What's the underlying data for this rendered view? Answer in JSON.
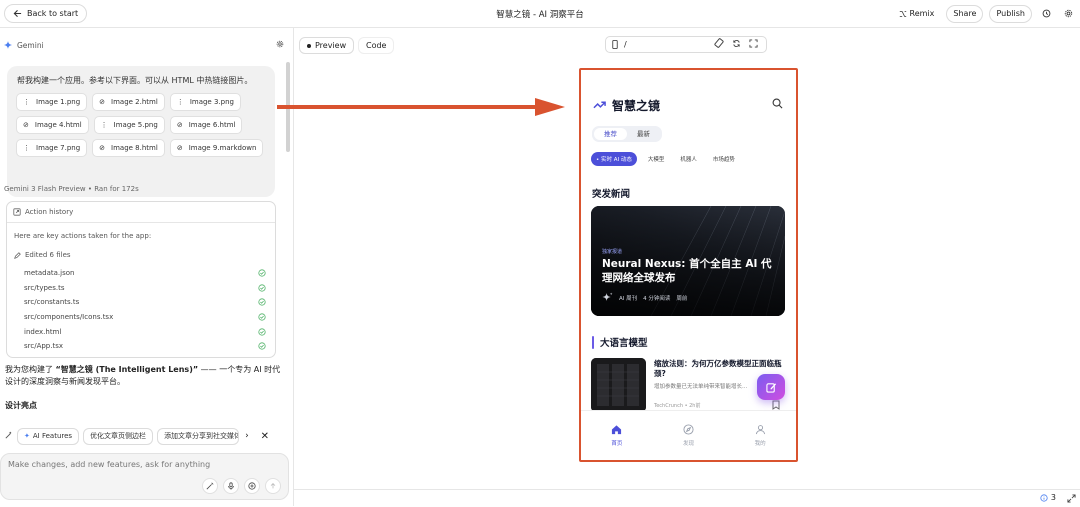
{
  "topbar": {
    "back_label": "Back to start",
    "title": "智慧之镜 - AI 洞察平台",
    "remix_label": "Remix",
    "share_label": "Share",
    "publish_label": "Publish"
  },
  "left": {
    "panel_label": "Gemini",
    "prompt_text": "帮我构建一个应用。参考以下界面。可以从 HTML 中热链接图片。",
    "attachments": [
      {
        "name": "Image 1.png",
        "icon": "image-file-icon"
      },
      {
        "name": "Image 2.html",
        "icon": "attachment-icon"
      },
      {
        "name": "Image 3.png",
        "icon": "image-file-icon"
      },
      {
        "name": "Image 4.html",
        "icon": "attachment-icon"
      },
      {
        "name": "Image 5.png",
        "icon": "image-file-icon"
      },
      {
        "name": "Image 6.html",
        "icon": "attachment-icon"
      },
      {
        "name": "Image 7.png",
        "icon": "image-file-icon"
      },
      {
        "name": "Image 8.html",
        "icon": "attachment-icon"
      },
      {
        "name": "Image 9.markdown",
        "icon": "attachment-icon"
      }
    ],
    "model": "Gemini 3 Flash Preview",
    "run_time": "Ran for 172s",
    "history_title": "Action history",
    "history_intro": "Here are key actions taken for the app:",
    "edited_label": "Edited 6 files",
    "files": [
      "metadata.json",
      "src/types.ts",
      "src/constants.ts",
      "src/components/Icons.tsx",
      "index.html",
      "src/App.tsx"
    ],
    "summary_prefix": "我为您构建了 ",
    "summary_bold": "“智慧之镜 (The Intelligent Lens)”",
    "summary_suffix": " —— 一个专为 AI 时代设计的深度洞察与新闻发现平台。",
    "design_heading": "设计亮点",
    "suggestions": [
      "AI Features",
      "优化文章页侧边栏",
      "添加文章分享到社交媒体"
    ],
    "composer_placeholder": "Make changes, add new features, ask for anything"
  },
  "preview": {
    "tab_preview": "Preview",
    "tab_code": "Code",
    "url": "/",
    "issues_count": "3"
  },
  "app": {
    "title": "智慧之镜",
    "tabs": [
      {
        "label": "推荐",
        "active": true
      },
      {
        "label": "最新",
        "active": false
      }
    ],
    "pills": [
      {
        "label": "• 实时 AI 动态",
        "active": true
      },
      {
        "label": "大模型",
        "active": false
      },
      {
        "label": "机器人",
        "active": false
      },
      {
        "label": "市场趋势",
        "active": false
      }
    ],
    "breaking_heading": "突发新闻",
    "hero": {
      "tag": "独家报道",
      "title": "Neural Nexus: 首个全自主 AI 代理网络全球发布",
      "source": "AI 周刊",
      "read_time": "4 分钟阅读",
      "date": "周前"
    },
    "llm_heading": "大语言模型",
    "article": {
      "title": "缩放法则：为何万亿参数模型正面临瓶颈?",
      "desc": "增加参数量已无法单纯带来智能增长...",
      "source": "TechCrunch • 2h前"
    },
    "nav": [
      {
        "label": "首页",
        "icon": "home-icon",
        "active": true
      },
      {
        "label": "发现",
        "icon": "compass-icon",
        "active": false
      },
      {
        "label": "我的",
        "icon": "user-icon",
        "active": false
      }
    ],
    "accent": "#4c4fd9"
  },
  "colors": {
    "highlight_border": "#d9532f",
    "arrow": "#d9532f"
  }
}
